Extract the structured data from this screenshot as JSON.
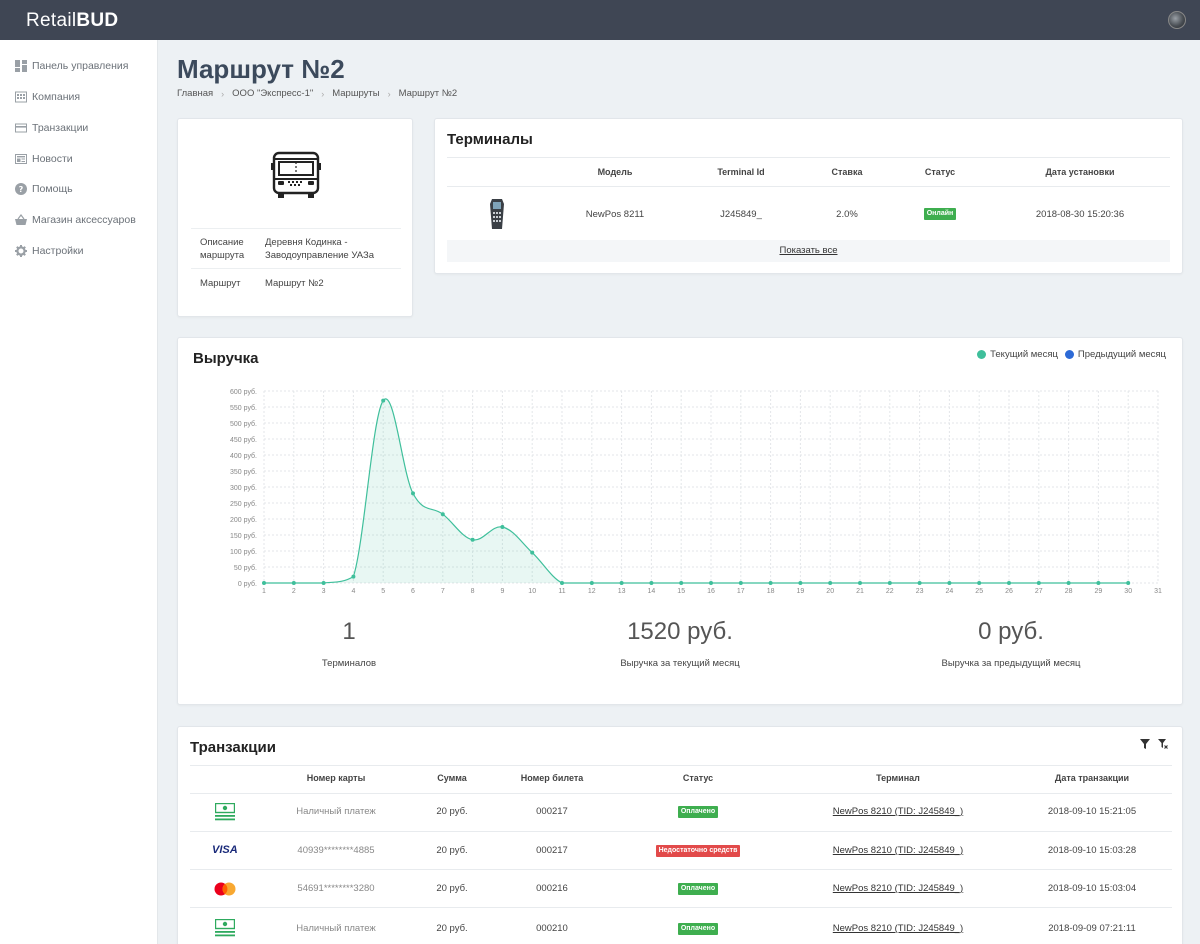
{
  "app": {
    "logo_light": "Retail",
    "logo_bold": "BUD"
  },
  "sidebar": {
    "items": [
      {
        "label": "Панель управления",
        "icon": "dashboard-icon"
      },
      {
        "label": "Компания",
        "icon": "building-icon"
      },
      {
        "label": "Транзакции",
        "icon": "credit-card-icon"
      },
      {
        "label": "Новости",
        "icon": "newspaper-icon"
      },
      {
        "label": "Помощь",
        "icon": "help-icon"
      },
      {
        "label": "Магазин аксессуаров",
        "icon": "basket-icon"
      },
      {
        "label": "Настройки",
        "icon": "gear-icon"
      }
    ]
  },
  "page": {
    "title": "Маршрут №2",
    "breadcrumb": [
      "Главная",
      "ООО \"Экспресс-1\"",
      "Маршруты",
      "Маршрут №2"
    ]
  },
  "route": {
    "desc_label": "Описание маршрута",
    "desc_value": "Деревня Кодинка - Заводоуправление УАЗа",
    "route_label": "Маршрут",
    "route_value": "Маршрут №2"
  },
  "terminals": {
    "title": "Терминалы",
    "headers": [
      "Модель",
      "Terminal Id",
      "Ставка",
      "Статус",
      "Дата установки"
    ],
    "rows": [
      {
        "model": "NewPos 8211",
        "terminal_id": "J245849_",
        "rate": "2.0%",
        "status": "Онлайн",
        "installed": "2018-08-30 15:20:36"
      }
    ],
    "show_all": "Показать все"
  },
  "revenue": {
    "title": "Выручка",
    "legend_current": "Текущий месяц",
    "legend_previous": "Предыдущий месяц",
    "stats": [
      {
        "value": "1",
        "label": "Терминалов"
      },
      {
        "value": "1520 руб.",
        "label": "Выручка за текущий месяц"
      },
      {
        "value": "0 руб.",
        "label": "Выручка за предыдущий месяц"
      }
    ]
  },
  "chart_data": {
    "type": "area",
    "x": [
      1,
      2,
      3,
      4,
      5,
      6,
      7,
      8,
      9,
      10,
      11,
      12,
      13,
      14,
      15,
      16,
      17,
      18,
      19,
      20,
      21,
      22,
      23,
      24,
      25,
      26,
      27,
      28,
      29,
      30,
      31
    ],
    "series": [
      {
        "name": "Текущий месяц",
        "color": "#3fbf9b",
        "values": [
          0,
          0,
          0,
          20,
          570,
          280,
          215,
          135,
          175,
          95,
          0,
          0,
          0,
          0,
          0,
          0,
          0,
          0,
          0,
          0,
          0,
          0,
          0,
          0,
          0,
          0,
          0,
          0,
          0,
          0
        ]
      },
      {
        "name": "Предыдущий месяц",
        "color": "#2d6ad6",
        "values": []
      }
    ],
    "yticks": [
      "600 руб.",
      "550 руб.",
      "500 руб.",
      "450 руб.",
      "400 руб.",
      "350 руб.",
      "300 руб.",
      "250 руб.",
      "200 руб.",
      "150 руб.",
      "100 руб.",
      "50 руб.",
      "0 руб."
    ],
    "ylim": [
      0,
      600
    ],
    "xlim": [
      1,
      31
    ],
    "grid": true,
    "legend": "top-right"
  },
  "transactions": {
    "title": "Транзакции",
    "headers": [
      "Номер карты",
      "Сумма",
      "Номер билета",
      "Статус",
      "Терминал",
      "Дата транзакции"
    ],
    "rows": [
      {
        "method": "cash-icon",
        "card": "Наличный платеж",
        "sum": "20 руб.",
        "ticket": "000217",
        "status": "Оплачено",
        "status_kind": "green",
        "terminal": "NewPos 8210 (TID: J245849_)",
        "date": "2018-09-10 15:21:05"
      },
      {
        "method": "visa-icon",
        "card": "40939********4885",
        "sum": "20 руб.",
        "ticket": "000217",
        "status": "Недостаточно средств",
        "status_kind": "red",
        "terminal": "NewPos 8210 (TID: J245849_)",
        "date": "2018-09-10 15:03:28"
      },
      {
        "method": "mastercard-icon",
        "card": "54691********3280",
        "sum": "20 руб.",
        "ticket": "000216",
        "status": "Оплачено",
        "status_kind": "green",
        "terminal": "NewPos 8210 (TID: J245849_)",
        "date": "2018-09-10 15:03:04"
      },
      {
        "method": "cash-icon",
        "card": "Наличный платеж",
        "sum": "20 руб.",
        "ticket": "000210",
        "status": "Оплачено",
        "status_kind": "green",
        "terminal": "NewPos 8210 (TID: J245849_)",
        "date": "2018-09-09 07:21:11"
      }
    ],
    "visa_text": "VISA"
  },
  "colors": {
    "topbar": "#3f4654",
    "accent_green": "#3fbf9b",
    "accent_blue": "#2d6ad6",
    "badge_green": "#3eae4f",
    "badge_red": "#e24a4a"
  }
}
